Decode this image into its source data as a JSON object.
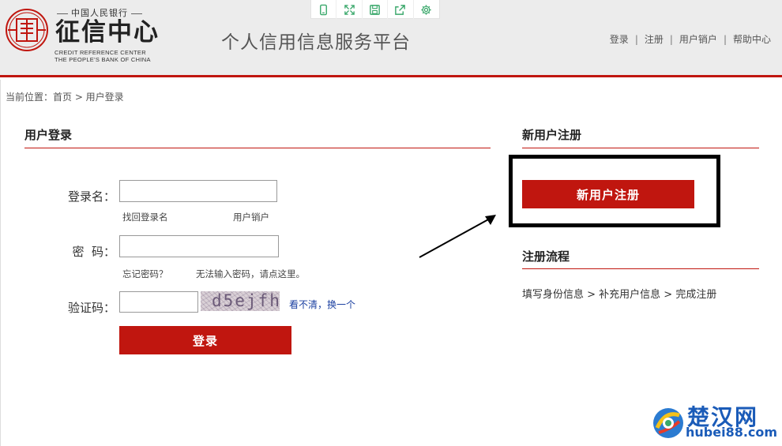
{
  "header": {
    "bank_name": "中国人民银行",
    "center_name": "征信中心",
    "english_line1": "CREDIT REFERENCE CENTER",
    "english_line2": "THE PEOPLE'S BANK OF CHINA",
    "site_title": "个人信用信息服务平台",
    "links": [
      "登录",
      "注册",
      "用户销户",
      "帮助中心"
    ],
    "separator": "|"
  },
  "toolbar": {
    "icons": [
      "tablet-icon",
      "fullscreen-icon",
      "save-icon",
      "share-icon",
      "settings-icon"
    ]
  },
  "breadcrumb": "当前位置：首页 > 用户登录",
  "login": {
    "title": "用户登录",
    "username_label": "登录名：",
    "username_value": "",
    "find_username_link": "找回登录名",
    "cancel_account_link": "用户销户",
    "password_label": "密  码：",
    "password_value": "",
    "forgot_password_link": "忘记密码？",
    "cannot_input_link": "无法输入密码，请点这里。",
    "captcha_label": "验证码：",
    "captcha_value": "",
    "captcha_code": "d5ejfh",
    "refresh_captcha_link": "看不清，换一个",
    "submit_label": "登录"
  },
  "register": {
    "title": "新用户注册",
    "button_label": "新用户注册",
    "flow_title": "注册流程",
    "flow_text": "填写身份信息 > 补充用户信息 > 完成注册"
  },
  "watermark": {
    "cn": "楚汉网",
    "en": "hubei88.com"
  },
  "colors": {
    "accent": "#c0160f",
    "link_blue": "#1a3fa0",
    "header_bg": "#ececec"
  }
}
